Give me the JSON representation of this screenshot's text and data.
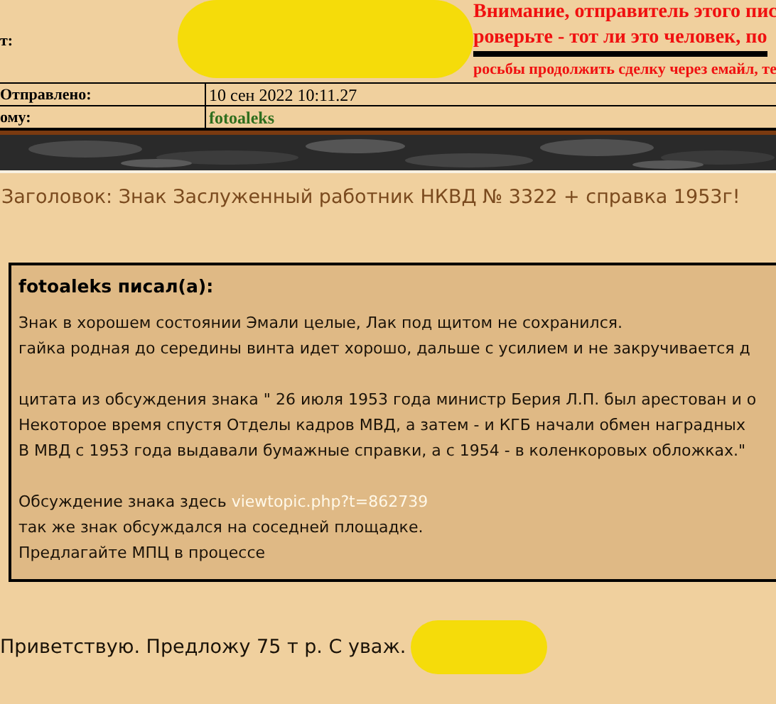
{
  "message_header": {
    "from": {
      "label": "т:",
      "warning_lines": [
        "Внимание, отправитель этого пис",
        "роверьте - тот ли это человек, по",
        "росьбы продолжить сделку через емайл, те"
      ]
    },
    "sent": {
      "label": "Отправлено:",
      "value": "10 сен 2022 10:11.27"
    },
    "to": {
      "label": "ому:",
      "value": "fotoaleks"
    }
  },
  "subject": "Заголовок: Знак Заслуженный работник НКВД № 3322 + справка 1953г!",
  "quote": {
    "author_line": "fotoaleks писал(а):",
    "paragraphs": [
      [
        {
          "text": "Знак в хорошем состоянии Эмали целые, Лак под щитом не сохранился."
        },
        {
          "text": "гайка родная до середины винта идет хорошо, дальше с усилием и не закручивается д"
        }
      ],
      [
        {
          "text": "цитата из обсуждения знака \" 26 июля 1953 года министр Берия Л.П. был арестован и о"
        },
        {
          "text": "Некоторое время спустя Отделы кадров МВД, а затем - и КГБ начали обмен наградных"
        },
        {
          "text": "В МВД с 1953 года выдавали бумажные справки, а с 1954 - в коленкоровых обложках.\""
        }
      ],
      [
        {
          "text": "Обсуждение знака здесь",
          "link": "viewtopic.php?t=862739"
        },
        {
          "text": "так же знак обсуждался на соседней площадке."
        },
        {
          "text": "Предлагайте МПЦ в процессе"
        }
      ]
    ]
  },
  "reply": "Приветствую. Предложу 75 т р. С уваж."
}
